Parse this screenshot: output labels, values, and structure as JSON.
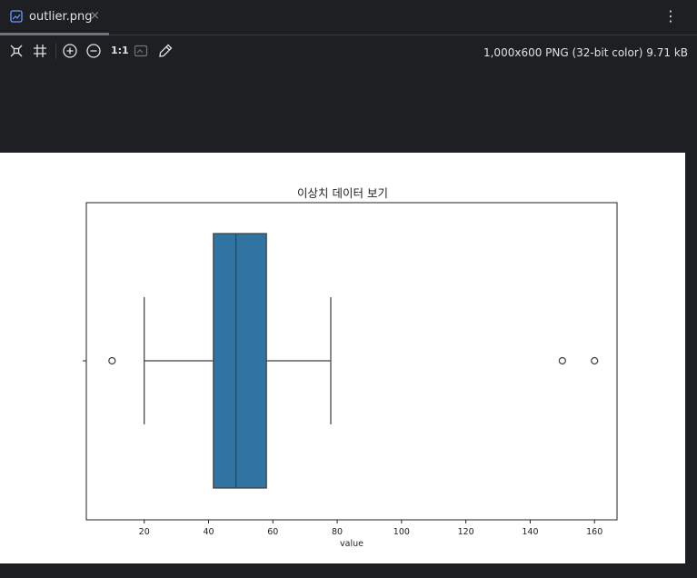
{
  "tab": {
    "label": "outlier.png",
    "close": "×"
  },
  "toolbar": {
    "actual_size": "1:1"
  },
  "image_info": "1,000x600 PNG (32-bit color) 9.71 kB",
  "colors": {
    "box": "#3274a1",
    "line": "#3d3d3d",
    "bg": "#1e1f22"
  },
  "chart_data": {
    "type": "boxplot",
    "title": "이상치 데이터 보기",
    "xlabel": "value",
    "xlim": [
      2,
      167
    ],
    "xticks": [
      20,
      40,
      60,
      80,
      100,
      120,
      140,
      160
    ],
    "box": {
      "whisker_low": 20,
      "q1": 41.5,
      "median": 48.5,
      "q3": 58,
      "whisker_high": 78
    },
    "outliers": [
      10,
      150,
      160
    ]
  }
}
